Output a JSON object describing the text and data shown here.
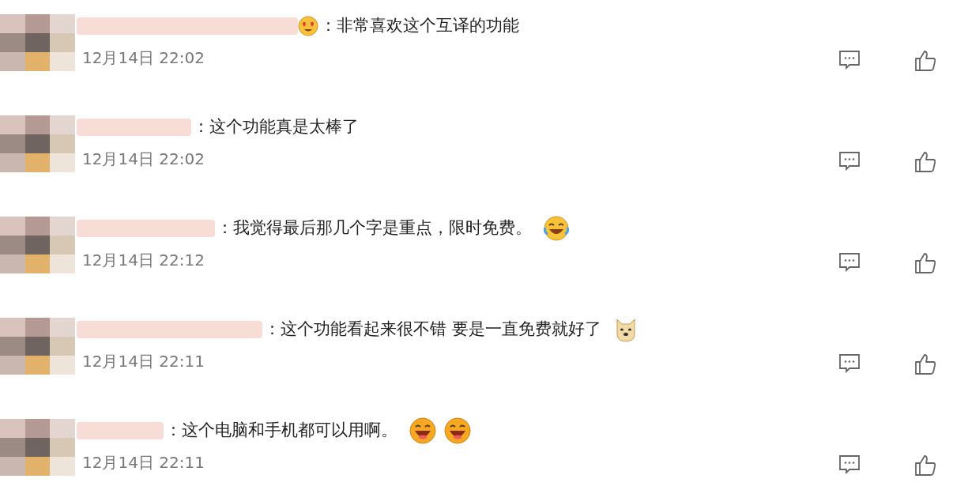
{
  "comments": [
    {
      "text": "：非常喜欢这个互译的功能",
      "time": "12月14日 22:02"
    },
    {
      "text": "：这个功能真是太棒了",
      "time": "12月14日 22:02"
    },
    {
      "text": "：我觉得最后那几个字是重点，限时免费。",
      "time": "12月14日 22:12"
    },
    {
      "text": "：这个功能看起来很不错 要是一直免费就好了",
      "time": "12月14日 22:11"
    },
    {
      "text": "：这个电脑和手机都可以用啊。",
      "time": "12月14日 22:11"
    }
  ]
}
